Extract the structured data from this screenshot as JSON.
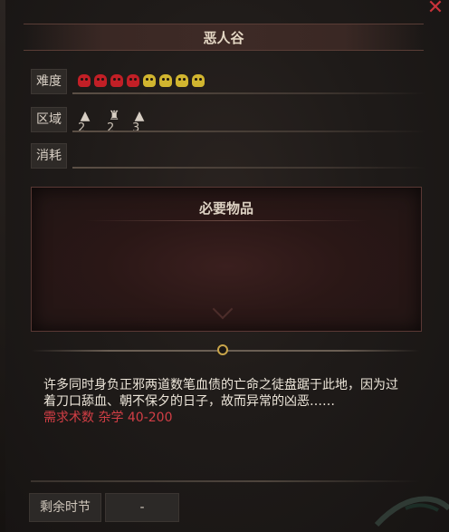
{
  "window": {
    "title": "恶人谷",
    "close_icon": "close-icon"
  },
  "difficulty": {
    "label": "难度",
    "skulls": [
      {
        "color": "red"
      },
      {
        "color": "red"
      },
      {
        "color": "red"
      },
      {
        "color": "red"
      },
      {
        "color": "yellow"
      },
      {
        "color": "yellow"
      },
      {
        "color": "yellow"
      },
      {
        "color": "yellow"
      }
    ]
  },
  "region": {
    "label": "区域",
    "tiles": [
      {
        "icon": "mountain-icon",
        "count": "2"
      },
      {
        "icon": "fortress-icon",
        "count": "2"
      },
      {
        "icon": "peak-icon",
        "count": "3"
      }
    ]
  },
  "cost": {
    "label": "消耗"
  },
  "required_items": {
    "title": "必要物品"
  },
  "description": "许多同时身负正邪两道数笔血债的亡命之徒盘踞于此地，因为过着刀口舔血、朝不保夕的日子，故而异常的凶恶……",
  "requirement": "需求术数 杂学 40-200",
  "footer": {
    "remaining_label": "剩余时节",
    "remaining_value": "-"
  },
  "colors": {
    "accent_red": "#d23e45",
    "skull_red": "#c21f26",
    "skull_yellow": "#d1b52f",
    "divider_gold": "#c8a44a"
  }
}
